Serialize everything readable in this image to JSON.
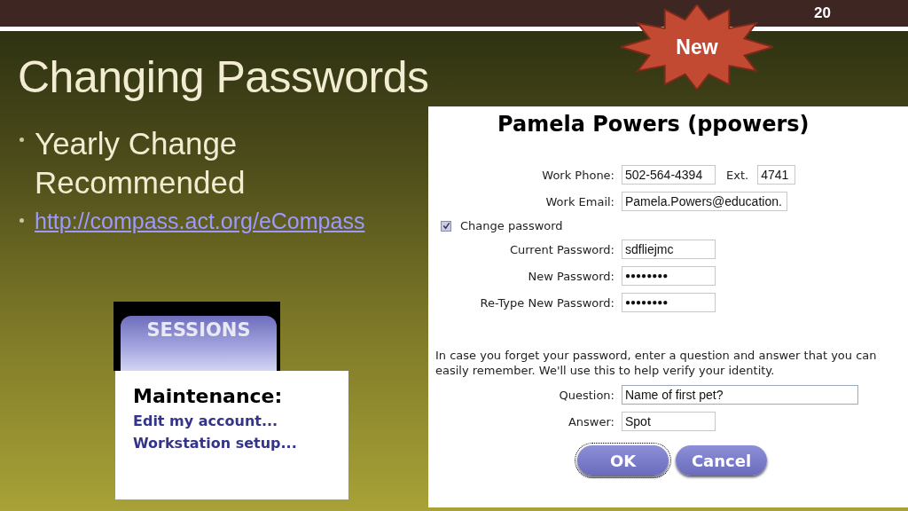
{
  "slide_number": "20",
  "badge": "New",
  "title": "Changing Passwords",
  "bullets": [
    {
      "kind": "text",
      "text": "Yearly Change Recommended"
    },
    {
      "kind": "link",
      "text": "http://compass.act.org/eCompass"
    }
  ],
  "sessions_tab": "SESSIONS",
  "maintenance": {
    "heading": "Maintenance:",
    "links": [
      "Edit my account...",
      "Workstation setup..."
    ]
  },
  "form": {
    "heading": "Pamela Powers (ppowers)",
    "phone": {
      "label": "Work Phone:",
      "value": "502-564-4394",
      "ext_label": "Ext.",
      "ext_value": "4741"
    },
    "email": {
      "label": "Work Email:",
      "value": "Pamela.Powers@education."
    },
    "change_password": {
      "label": "Change password",
      "checked": true
    },
    "passwords": [
      {
        "label": "Current Password:",
        "value": "sdfliejmc"
      },
      {
        "label": "New Password:",
        "value": "●●●●●●●●"
      },
      {
        "label": "Re-Type New Password:",
        "value": "●●●●●●●●"
      }
    ],
    "hint": "In case you forget your password, enter a question and answer that you can easily remember. We'll use this to help verify your identity.",
    "question": {
      "label": "Question:",
      "value": "Name of first pet?"
    },
    "answer": {
      "label": "Answer:",
      "value": "Spot"
    },
    "buttons": [
      {
        "label": "OK",
        "focused": true
      },
      {
        "label": "Cancel",
        "focused": false
      }
    ]
  }
}
